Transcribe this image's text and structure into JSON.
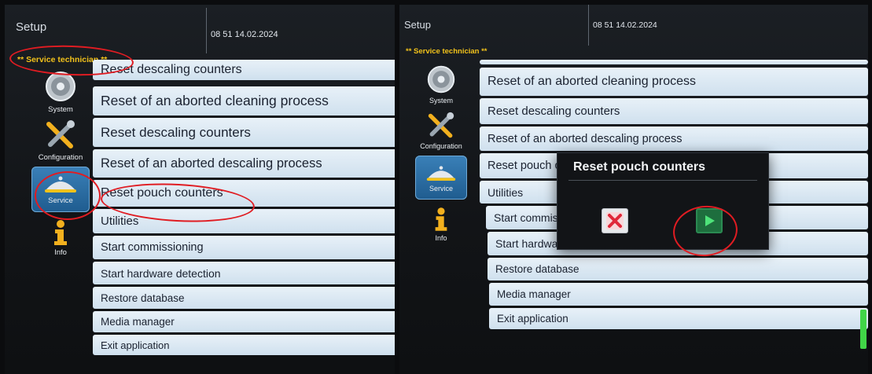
{
  "left_screen": {
    "title": "Setup",
    "datetime": "08 51 14.02.2024",
    "role": "** Service technician **",
    "nav": [
      {
        "label": "System",
        "icon": "gear-icon"
      },
      {
        "label": "Configuration",
        "icon": "tools-icon"
      },
      {
        "label": "Service",
        "icon": "service-bell-icon",
        "active": true
      },
      {
        "label": "Info",
        "icon": "info-icon"
      }
    ],
    "menu": {
      "partial_top": "Reset descaling counters",
      "items": [
        "Reset of an aborted cleaning process",
        "Reset descaling counters",
        "Reset of an aborted descaling process",
        "Reset pouch counters",
        "Utilities",
        "Start commissioning",
        "Start hardware detection",
        "Restore database",
        "Media manager",
        "Exit application"
      ]
    }
  },
  "right_screen": {
    "title": "Setup",
    "datetime": "08 51 14.02.2024",
    "role": "** Service technician **",
    "nav": [
      {
        "label": "System",
        "icon": "gear-icon"
      },
      {
        "label": "Configuration",
        "icon": "tools-icon"
      },
      {
        "label": "Service",
        "icon": "service-bell-icon",
        "active": true
      },
      {
        "label": "Info",
        "icon": "info-icon"
      }
    ],
    "menu": {
      "items": [
        "Reset of an aborted cleaning process",
        "Reset descaling counters",
        "Reset of an aborted descaling process",
        "Reset pouch counters",
        "Utilities",
        "Start commissioning",
        "Start hardware detection",
        "Restore database",
        "Media manager",
        "Exit application"
      ]
    },
    "dialog": {
      "title": "Reset pouch counters",
      "cancel_icon": "close-icon",
      "confirm_icon": "play-icon"
    }
  },
  "colors": {
    "accent_yellow": "#f2c21b",
    "annotation_red": "#e01c22",
    "row_fill": "#d9e8f3",
    "confirm_green": "#1e6e3e",
    "scroll_green": "#41d447"
  }
}
